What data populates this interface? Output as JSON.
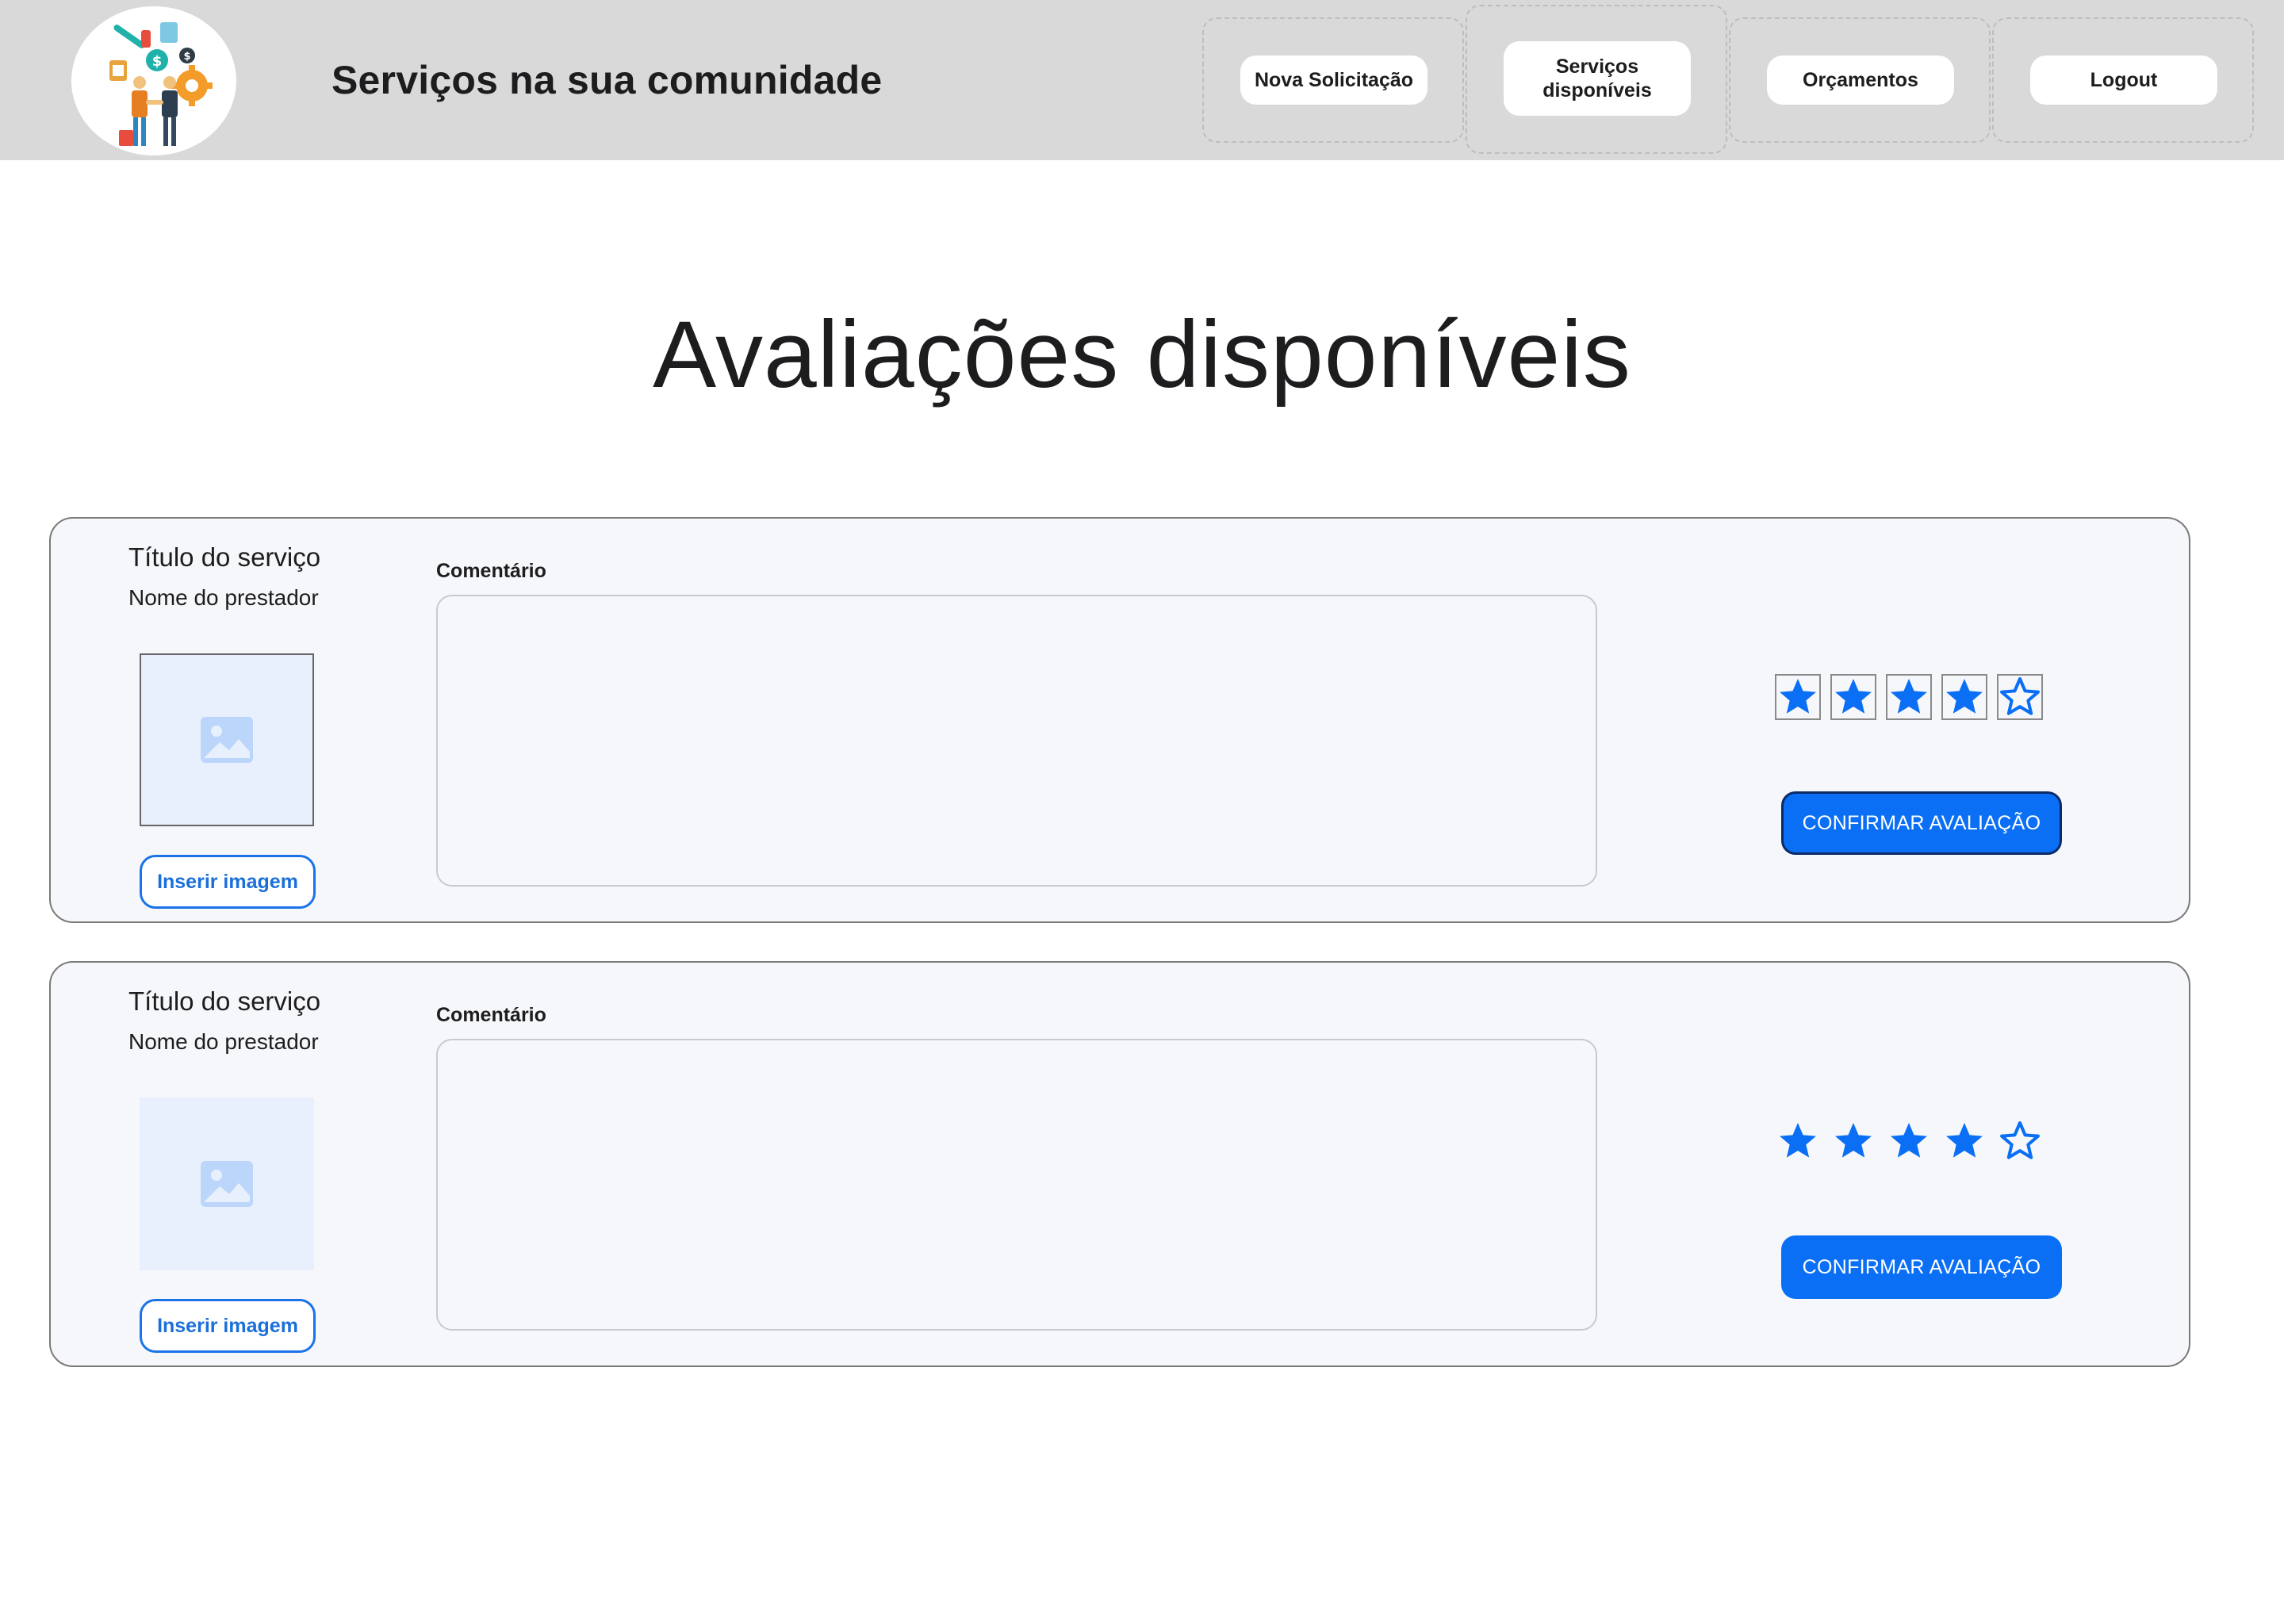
{
  "header": {
    "title": "Serviços na sua comunidade",
    "nav": [
      {
        "label": "Nova Solicitação"
      },
      {
        "label": "Serviços disponíveis",
        "active": true
      },
      {
        "label": "Orçamentos"
      },
      {
        "label": "Logout"
      }
    ]
  },
  "page": {
    "title": "Avaliações disponíveis"
  },
  "cards": [
    {
      "service_title": "Título do serviço",
      "provider_name": "Nome do prestador",
      "image_button": "Inserir imagem",
      "comment_label": "Comentário",
      "comment_value": "",
      "rating": 4,
      "max_rating": 5,
      "confirm_label": "CONFIRMAR AVALIAÇÃO"
    },
    {
      "service_title": "Título do serviço",
      "provider_name": "Nome do prestador",
      "image_button": "Inserir imagem",
      "comment_label": "Comentário",
      "comment_value": "",
      "rating": 4,
      "max_rating": 5,
      "confirm_label": "CONFIRMAR AVALIAÇÃO"
    }
  ],
  "colors": {
    "accent": "#0a6ff5",
    "header_bg": "#d9d9d9",
    "card_bg": "#f6f7fb",
    "image_placeholder_bg": "#e8f0fd"
  },
  "icons": {
    "logo": "community-services-logo",
    "image_placeholder": "image-icon",
    "star_filled": "star-filled-icon",
    "star_empty": "star-outline-icon"
  }
}
